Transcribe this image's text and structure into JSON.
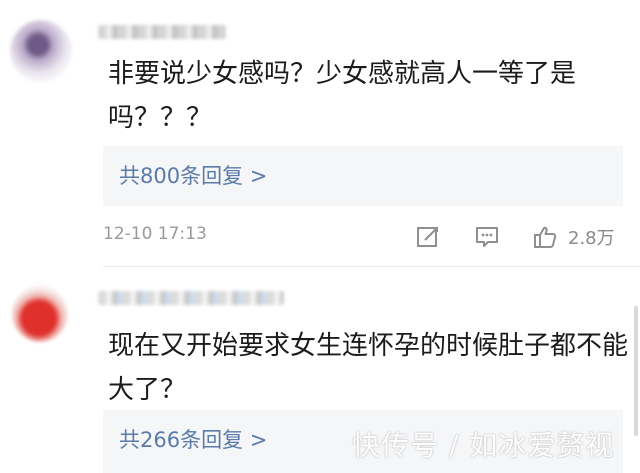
{
  "comments": [
    {
      "text": "非要说少女感吗？少女感就高人一等了是吗？？？",
      "replies_label": "共800条回复 >",
      "time": "12-10 17:13",
      "likes": "2.8万"
    },
    {
      "text": "现在又开始要求女生连怀孕的时候肚子都不能大了？",
      "replies_label": "共266条回复 >"
    }
  ],
  "watermark": "快传号 / 如冰爱赘视",
  "icons": {
    "edit": "edit-icon",
    "comment": "comment-icon",
    "like": "thumbs-up-icon"
  },
  "colors": {
    "reply_link": "#5a7ba8",
    "meta_text": "#9a9a9a",
    "reply_bg": "#f5f6f8"
  }
}
